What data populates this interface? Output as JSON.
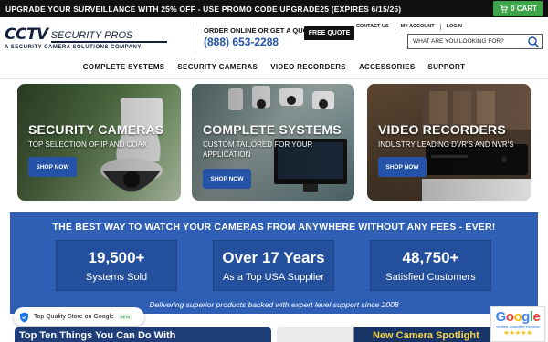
{
  "promo": {
    "text": "UPGRADE YOUR SURVEILLANCE WITH 25% OFF - USE PROMO CODE UPGRADE25 (EXPIRES 6/15/25)"
  },
  "cart": {
    "label": "0 CART",
    "icon": "cart-icon"
  },
  "logo": {
    "brand": "CCTV",
    "name": "SECURITY PROS",
    "tagline": "A SECURITY CAMERA SOLUTIONS COMPANY"
  },
  "contact": {
    "order_text": "ORDER ONLINE OR GET A QUOTE",
    "phone": "(888) 653-2288",
    "quote_button": "FREE QUOTE"
  },
  "top_links": [
    "CONTACT US",
    "MY ACCOUNT",
    "LOGIN"
  ],
  "search": {
    "placeholder": "WHAT ARE YOU LOOKING FOR?",
    "icon": "search-icon"
  },
  "nav": [
    "COMPLETE SYSTEMS",
    "SECURITY CAMERAS",
    "VIDEO RECORDERS",
    "ACCESSORIES",
    "SUPPORT"
  ],
  "cards": [
    {
      "title": "SECURITY CAMERAS",
      "desc": "TOP SELECTION OF IP AND COAX",
      "button": "SHOP NOW"
    },
    {
      "title": "COMPLETE SYSTEMS",
      "desc": "CUSTOM TAILORED FOR YOUR APPLICATION",
      "button": "SHOP NOW"
    },
    {
      "title": "VIDEO RECORDERS",
      "desc": "INDUSTRY LEADING DVR'S AND NVR'S",
      "button": "SHOP NOW"
    }
  ],
  "band": {
    "headline": "THE BEST WAY TO WATCH YOUR CAMERAS FROM ANYWHERE WITHOUT ANY FEES - EVER!",
    "stats": [
      {
        "value": "19,500+",
        "label": "Systems Sold"
      },
      {
        "value": "Over 17 Years",
        "label": "As a Top USA Supplier"
      },
      {
        "value": "48,750+",
        "label": "Satisfied Customers"
      }
    ],
    "tagline": "Delivering superior products backed with expert level support since 2008"
  },
  "badge": {
    "text": "Top Quality Store on Google",
    "beta": "BETA"
  },
  "google_review": {
    "word": "Google",
    "verified": "Verified Customer Reviews",
    "stars": "★★★★★"
  },
  "bottom": {
    "left_title": "Top Ten Things You Can Do With",
    "right_title": "New Camera Spotlight"
  },
  "colors": {
    "accent": "#2553a8",
    "cart": "#3fa34a",
    "band": "#2f5fb5"
  }
}
